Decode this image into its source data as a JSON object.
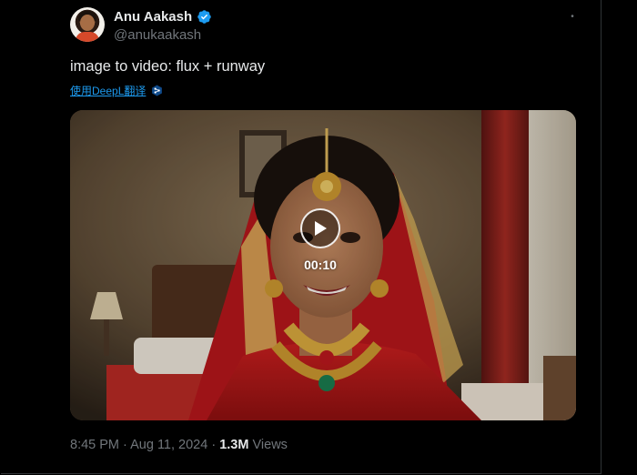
{
  "author": {
    "display_name": "Anu Aakash",
    "handle": "@anukaakash"
  },
  "tweet": {
    "text": "image to video: flux + runway",
    "translate_label": "使用DeepL翻译"
  },
  "video": {
    "duration": "00:10"
  },
  "meta": {
    "time": "8:45 PM",
    "separator": "·",
    "date": "Aug 11, 2024",
    "views_count": "1.3M",
    "views_label": "Views"
  },
  "colors": {
    "background": "#000000",
    "text_primary": "#e7e9ea",
    "text_secondary": "#71767b",
    "link": "#1d9bf0",
    "verified": "#1d9bf0"
  },
  "icons": {
    "verified": "verified-badge-icon",
    "more": "more-options-icon",
    "play": "play-icon",
    "deepl": "deepl-icon"
  }
}
